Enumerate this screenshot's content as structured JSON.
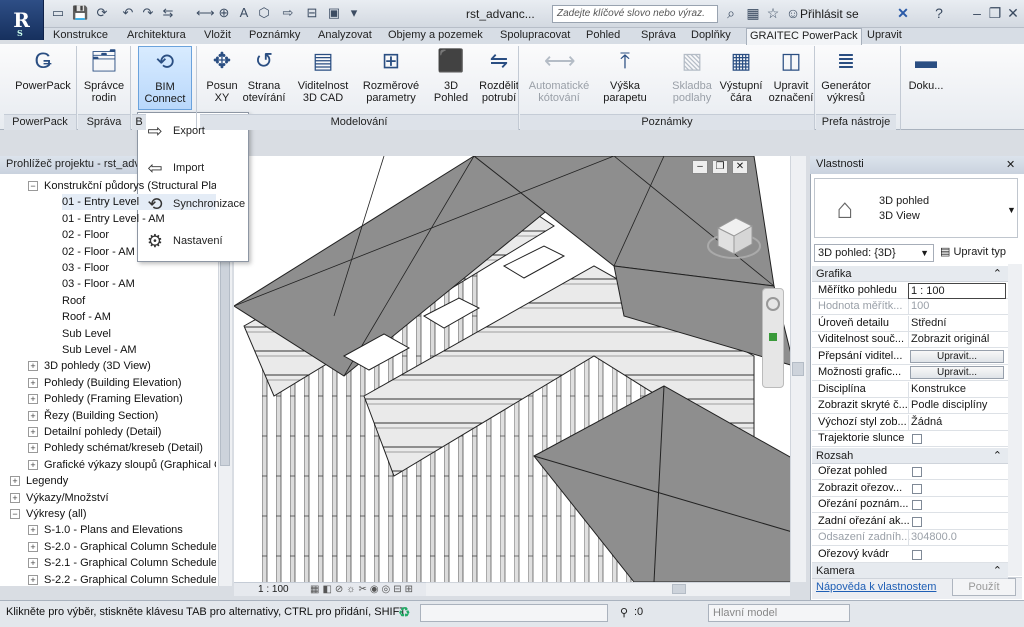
{
  "app": {
    "logo": "R",
    "logo_sub": "S",
    "title": "rst_advanc...",
    "search_placeholder": "Zadejte klíčové slovo nebo výraz.",
    "signin": "Přihlásit se"
  },
  "quick_access": [
    "open-icon",
    "save-icon",
    "sync-icon",
    "undo-icon",
    "redo-icon",
    "measure-icon",
    "dimension-icon",
    "tag-icon",
    "text-icon",
    "3d-icon",
    "section-icon",
    "close-views-icon",
    "switch-windows-icon",
    "dropdown-icon"
  ],
  "tabs": [
    "Konstrukce",
    "Architektura",
    "Vložit",
    "Poznámky",
    "Analyzovat",
    "Objemy a pozemek",
    "Spolupracovat",
    "Pohled",
    "Správa",
    "Doplňky",
    "GRAITEC PowerPack",
    "Upravit"
  ],
  "active_tab": "GRAITEC PowerPack",
  "ribbon": {
    "buttons": [
      {
        "label": "PowerPack",
        "icon": "graitec-icon"
      },
      {
        "label": "Správce\nrodin",
        "icon": "family-manager-icon"
      },
      {
        "label": "BIM\nConnect",
        "icon": "bim-connect-icon"
      },
      {
        "label": "Posun\nXY",
        "icon": "move-xy-icon"
      },
      {
        "label": "Strana\notevírání",
        "icon": "opening-side-icon"
      },
      {
        "label": "Viditelnost\n3D CAD",
        "icon": "dwg-rfa-icon"
      },
      {
        "label": "Rozměrové\nparametry",
        "icon": "dimension-params-icon"
      },
      {
        "label": "3D\nPohled",
        "icon": "3d-view-icon"
      },
      {
        "label": "Rozdělit\npotrubí",
        "icon": "split-pipe-icon"
      },
      {
        "label": "Automatické\nkótování",
        "icon": "auto-dimension-icon"
      },
      {
        "label": "Výška\nparapetu",
        "icon": "sill-height-icon"
      },
      {
        "label": "Skladba\npodlahy",
        "icon": "floor-layers-icon"
      },
      {
        "label": "Výstupní\nčára",
        "icon": "output-line-icon"
      },
      {
        "label": "Upravit\noznačení",
        "icon": "edit-mark-icon"
      },
      {
        "label": "Generátor\nvýkresů",
        "icon": "sheet-generator-icon"
      },
      {
        "label": "Doku...",
        "icon": "documentation-icon"
      }
    ],
    "groups": [
      "PowerPack",
      "Správa",
      "B",
      "Modelování",
      "Poznámky",
      "Prefa nástroje"
    ]
  },
  "bim_menu": [
    {
      "label": "Export",
      "icon": "export-icon"
    },
    {
      "label": "Import",
      "icon": "import-icon"
    },
    {
      "label": "Synchronizace",
      "icon": "sync-icon"
    },
    {
      "label": "Nastavení",
      "icon": "settings-icon"
    }
  ],
  "browser": {
    "title": "Prohlížeč projektu - rst_advanced_sample_project.rvt",
    "items": [
      {
        "label": "Konstrukční půdorys (Structural Plan)",
        "level": 1,
        "toggle": "−"
      },
      {
        "label": "01 - Entry Level",
        "level": 2,
        "selected": true
      },
      {
        "label": "01 - Entry Level - AM",
        "level": 2
      },
      {
        "label": "02 - Floor",
        "level": 2
      },
      {
        "label": "02 - Floor - AM",
        "level": 2
      },
      {
        "label": "03 - Floor",
        "level": 2
      },
      {
        "label": "03 - Floor - AM",
        "level": 2
      },
      {
        "label": "Roof",
        "level": 2
      },
      {
        "label": "Roof - AM",
        "level": 2
      },
      {
        "label": "Sub Level",
        "level": 2
      },
      {
        "label": "Sub Level - AM",
        "level": 2
      },
      {
        "label": "3D pohledy (3D View)",
        "level": 1,
        "toggle": "+"
      },
      {
        "label": "Pohledy (Building Elevation)",
        "level": 1,
        "toggle": "+"
      },
      {
        "label": "Pohledy (Framing Elevation)",
        "level": 1,
        "toggle": "+"
      },
      {
        "label": "Řezy (Building Section)",
        "level": 1,
        "toggle": "+"
      },
      {
        "label": "Detailní pohledy (Detail)",
        "level": 1,
        "toggle": "+"
      },
      {
        "label": "Pohledy schémat/kreseb (Detail)",
        "level": 1,
        "toggle": "+"
      },
      {
        "label": "Grafické výkazy sloupů (Graphical Column Schedule)",
        "level": 1,
        "toggle": "+"
      },
      {
        "label": "Legendy",
        "level": 0,
        "toggle": "+"
      },
      {
        "label": "Výkazy/Množství",
        "level": 0,
        "toggle": "+"
      },
      {
        "label": "Výkresy (all)",
        "level": 0,
        "toggle": "−"
      },
      {
        "label": "S-1.0 - Plans and Elevations",
        "level": 1,
        "toggle": "+"
      },
      {
        "label": "S-2.0 - Graphical Column Schedule",
        "level": 1,
        "toggle": "+"
      },
      {
        "label": "S-2.1 - Graphical Column Schedule",
        "level": 1,
        "toggle": "+"
      },
      {
        "label": "S-2.2 - Graphical Column Schedule",
        "level": 1,
        "toggle": "+"
      }
    ]
  },
  "view": {
    "scale": "1 : 100",
    "viewcube_label": "ZAPADNÍ"
  },
  "properties": {
    "title": "Vlastnosti",
    "type_name": "3D pohled",
    "type_sub": "3D View",
    "selector": "3D pohled: {3D}",
    "edit_type": "Upravit typ",
    "sections": [
      {
        "name": "Grafika",
        "rows": [
          {
            "k": "Měřítko pohledu",
            "v": "1 : 100",
            "kind": "input"
          },
          {
            "k": "Hodnota měřítk...",
            "v": "100",
            "kind": "dis"
          },
          {
            "k": "Úroveň detailu",
            "v": "Střední"
          },
          {
            "k": "Viditelnost souč...",
            "v": "Zobrazit originál"
          },
          {
            "k": "Přepsání viditel...",
            "v": "Upravit...",
            "kind": "button"
          },
          {
            "k": "Možnosti grafic...",
            "v": "Upravit...",
            "kind": "button"
          },
          {
            "k": "Disciplína",
            "v": "Konstrukce"
          },
          {
            "k": "Zobrazit skryté č...",
            "v": "Podle disciplíny"
          },
          {
            "k": "Výchozí styl zob...",
            "v": "Žádná"
          },
          {
            "k": "Trajektorie slunce",
            "v": "",
            "kind": "check"
          }
        ]
      },
      {
        "name": "Rozsah",
        "rows": [
          {
            "k": "Ořezat pohled",
            "v": "",
            "kind": "check"
          },
          {
            "k": "Zobrazit ořezov...",
            "v": "",
            "kind": "check"
          },
          {
            "k": "Ořezání poznám...",
            "v": "",
            "kind": "check"
          },
          {
            "k": "Zadní ořezání ak...",
            "v": "",
            "kind": "check"
          },
          {
            "k": "Odsazení zadníh...",
            "v": "304800.0",
            "kind": "dis"
          },
          {
            "k": "Ořezový kvádr",
            "v": "",
            "kind": "check"
          }
        ]
      },
      {
        "name": "Kamera",
        "rows": []
      }
    ],
    "help_link": "Nápověda k vlastnostem",
    "apply": "Použít"
  },
  "status": {
    "text": "Klikněte pro výběr, stiskněte klávesu TAB pro alternativy, CTRL pro přidání, SHIFT",
    "zero": ":0",
    "model": "Hlavní model"
  }
}
